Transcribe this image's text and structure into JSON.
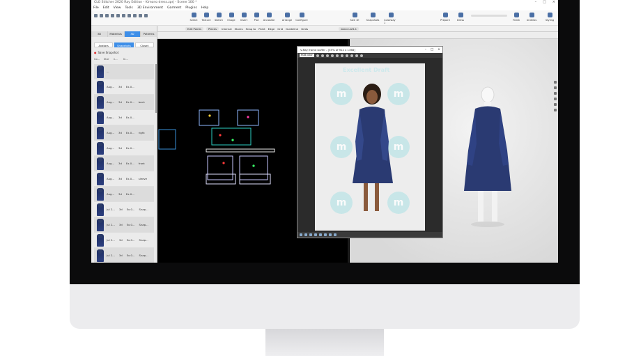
{
  "window": {
    "title": "CLO Stitcher 2020 Ray Edition - Kimono dress.zprj - Scene 100 *",
    "controls": [
      "–",
      "□",
      "×"
    ]
  },
  "menu": {
    "items": [
      "File",
      "Edit",
      "View",
      "Tools",
      "3D Environment",
      "Garment",
      "Plugins",
      "Help"
    ]
  },
  "toolbar": {
    "tools": [
      {
        "label": "Select",
        "icon": "select-icon"
      },
      {
        "label": "Texture",
        "icon": "texture-icon"
      },
      {
        "label": "Sketch",
        "icon": "sketch-icon"
      },
      {
        "label": "Image",
        "icon": "image-icon"
      },
      {
        "label": "Insert",
        "icon": "insert-icon"
      },
      {
        "label": "Plot",
        "icon": "plot-icon"
      },
      {
        "label": "Annotate",
        "icon": "annotate-icon"
      },
      {
        "label": "Arrange",
        "icon": "arrange-icon"
      },
      {
        "label": "Configure",
        "icon": "configure-icon"
      },
      {
        "label": "Size 1E",
        "icon": "size-icon"
      },
      {
        "label": "Snapshots",
        "icon": "snapshots-icon"
      },
      {
        "label": "Colorway 1",
        "icon": "colorway-icon"
      },
      {
        "label": "Prepare",
        "icon": "prepare-icon"
      },
      {
        "label": "Dress",
        "icon": "dress-icon"
      },
      {
        "label": "Finish",
        "icon": "finish-icon"
      },
      {
        "label": "Undress",
        "icon": "undress-icon"
      },
      {
        "label": "Styling",
        "icon": "styling-icon"
      }
    ]
  },
  "left_panel": {
    "tabs": [
      "3D",
      "Materials",
      "3D",
      "Patterns"
    ],
    "active_tab_index": 2,
    "subtabs": [
      "Avatars",
      "Snapshots",
      "Closet"
    ],
    "active_subtab_index": 1,
    "save_snapshot": "Save Snapshot",
    "columns": [
      "Co...",
      "Stor",
      "n...",
      "In..."
    ],
    "rows": [
      {
        "c1": "...",
        "c2": "",
        "c3": "",
        "c4": ""
      },
      {
        "c1": "Aug...",
        "c2": "3d",
        "c3": "Ex.0...",
        "c4": ""
      },
      {
        "c1": "Aug...",
        "c2": "3d",
        "c3": "Ex.0...",
        "c4": "back"
      },
      {
        "c1": "Aug...",
        "c2": "3d",
        "c3": "Ex.0...",
        "c4": ""
      },
      {
        "c1": "Aug...",
        "c2": "3d",
        "c3": "Ex.0...",
        "c4": "right"
      },
      {
        "c1": "Aug...",
        "c2": "3d",
        "c3": "Ex.0...",
        "c4": ""
      },
      {
        "c1": "Aug...",
        "c2": "3d",
        "c3": "Ex.0...",
        "c4": "front"
      },
      {
        "c1": "Aug...",
        "c2": "3d",
        "c3": "Ex.0...",
        "c4": "sleeve"
      },
      {
        "c1": "Aug...",
        "c2": "3d",
        "c3": "Ex.0...",
        "c4": ""
      },
      {
        "c1": "Jul 2...",
        "c2": "3d",
        "c3": "Ex.0...",
        "c4": "Snap..."
      },
      {
        "c1": "Jul 2...",
        "c2": "3d",
        "c3": "Ex.0...",
        "c4": "Snap..."
      },
      {
        "c1": "Jul 2...",
        "c2": "3d",
        "c3": "Ex.0...",
        "c4": "Snap..."
      },
      {
        "c1": "Jul 2...",
        "c2": "3d",
        "c3": "Ex.0...",
        "c4": "Snap..."
      }
    ]
  },
  "secondary_toolbar": {
    "items": [
      "Edit Points",
      "Pieces",
      "Internal",
      "Stores",
      "Snap to",
      "Point",
      "Edge",
      "Grid",
      "Guideline",
      "Grids"
    ],
    "avatar_select": "dance-loft-1"
  },
  "render_window": {
    "title": "V-Ray frame buffer - [55% of 912 x 1368]",
    "channel": "RGB color",
    "watermark_text": "Excellent Draft",
    "watermark_letter": "m"
  },
  "colors": {
    "accent": "#3d8ee8",
    "dress": "#2a3a72",
    "viewport2d": "#000000"
  }
}
